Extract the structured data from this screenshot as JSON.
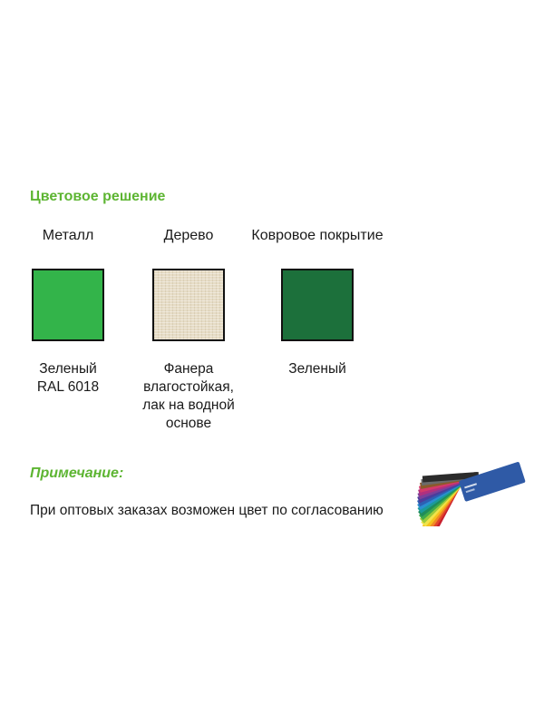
{
  "section_title": "Цветовое решение",
  "columns": [
    {
      "label": "Металл",
      "swatch_color": "#33b44a",
      "desc_lines": [
        "Зеленый",
        "RAL 6018"
      ]
    },
    {
      "label": "Дерево",
      "swatch_color": "#e6dcc6",
      "desc_lines": [
        "Фанера",
        "влагостойкая,",
        "лак на водной",
        "основе"
      ]
    },
    {
      "label": "Ковровое покрытие",
      "swatch_color": "#1c703b",
      "desc_lines": [
        "Зеленый"
      ]
    }
  ],
  "note": {
    "title": "Примечание:",
    "text": "При оптовых заказах возможен цвет по согласованию"
  },
  "colors": {
    "accent_green": "#5db532",
    "fan_cover": "#2f5aa6"
  }
}
